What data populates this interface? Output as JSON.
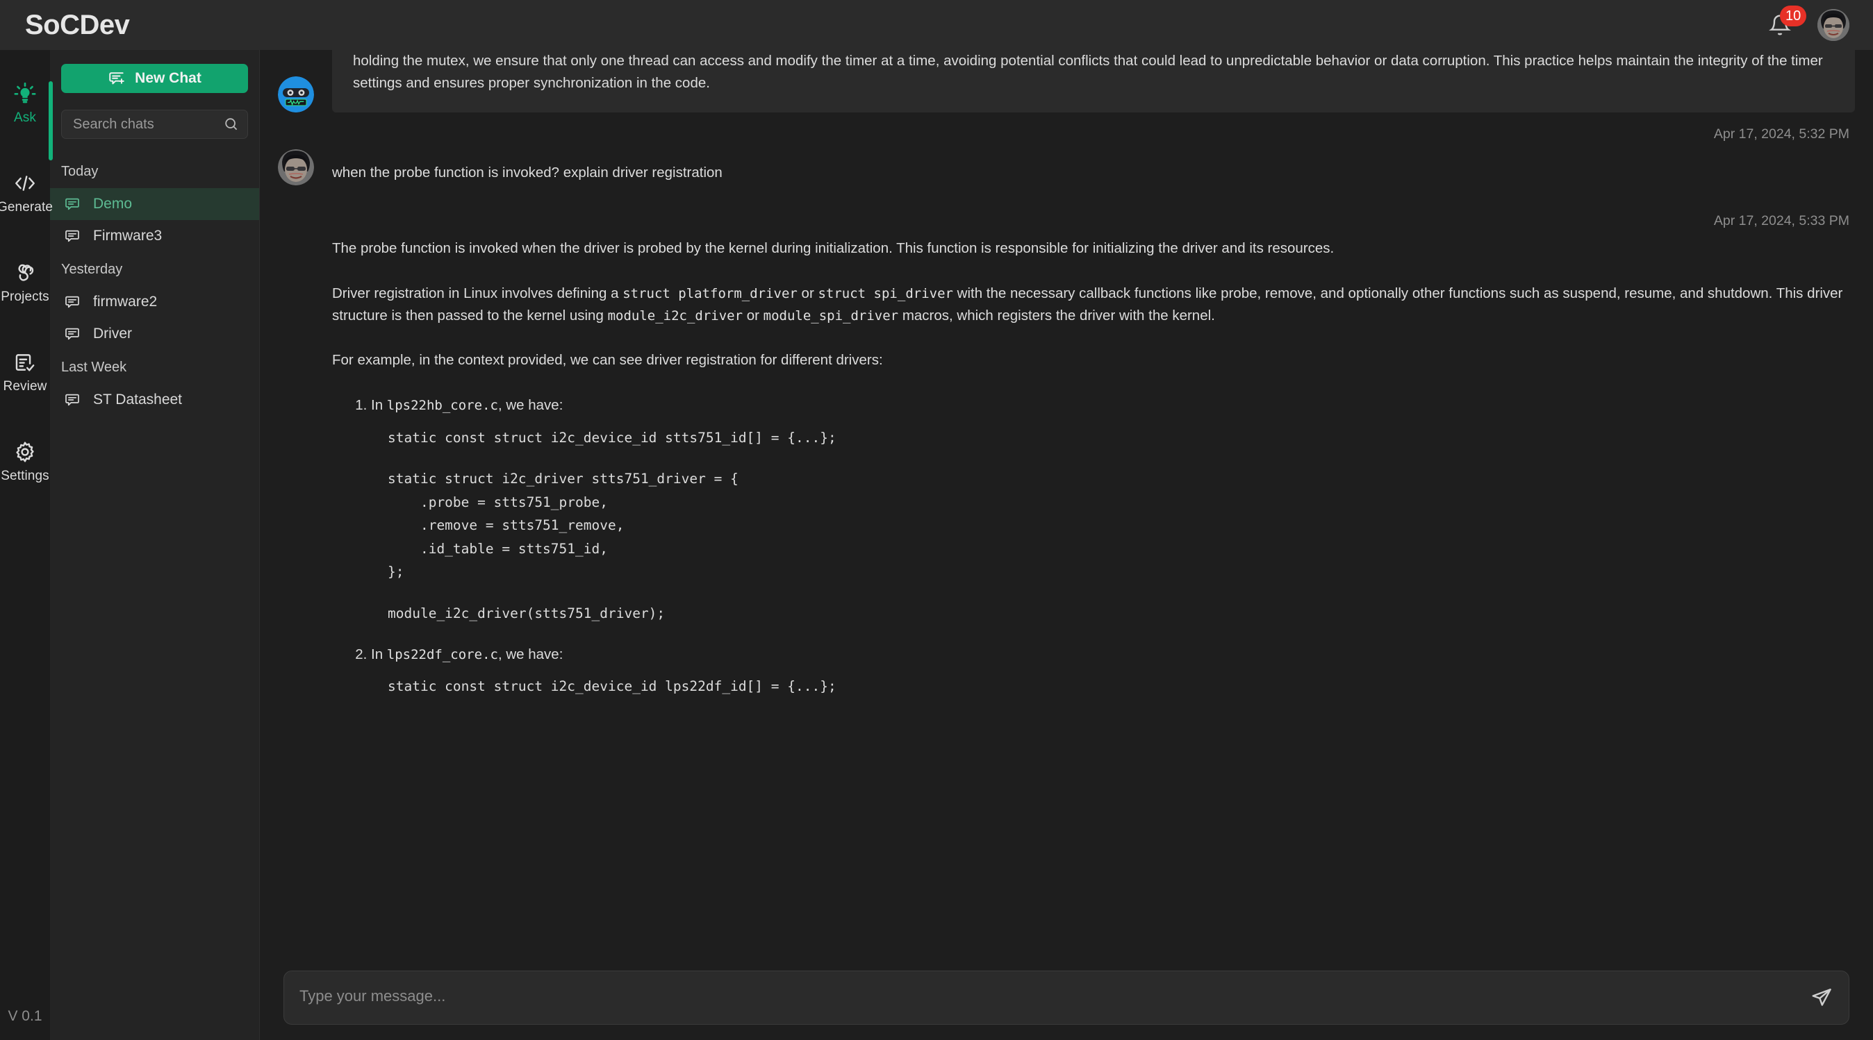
{
  "header": {
    "brand": "SoCDev",
    "notification_count": "10",
    "bell_icon": "bell-icon",
    "avatar": "user-avatar"
  },
  "rail": {
    "version": "V 0.1",
    "items": [
      {
        "label": "Ask",
        "icon": "lightbulb-icon",
        "active": true
      },
      {
        "label": "Generate",
        "icon": "code-brackets-icon",
        "active": false
      },
      {
        "label": "Projects",
        "icon": "pinwheel-icon",
        "active": false
      },
      {
        "label": "Review",
        "icon": "document-check-icon",
        "active": false
      },
      {
        "label": "Settings",
        "icon": "gear-icon",
        "active": false
      }
    ]
  },
  "sidebar": {
    "new_chat_label": "New Chat",
    "new_chat_icon": "new-message-icon",
    "search_placeholder": "Search chats",
    "search_value": "",
    "search_icon": "search-icon",
    "groups": [
      {
        "label": "Today",
        "items": [
          {
            "title": "Demo",
            "active": true
          },
          {
            "title": "Firmware3",
            "active": false
          }
        ]
      },
      {
        "label": "Yesterday",
        "items": [
          {
            "title": "firmware2",
            "active": false
          },
          {
            "title": "Driver",
            "active": false
          }
        ]
      },
      {
        "label": "Last Week",
        "items": [
          {
            "title": "ST Datasheet",
            "active": false
          }
        ]
      }
    ]
  },
  "thread": {
    "bot_message_partial": "holding the mutex, we ensure that only one thread can access and modify the timer at a time, avoiding potential conflicts that could lead to unpredictable behavior or data corruption. This practice helps maintain the integrity of the timer settings and ensures proper synchronization in the code.",
    "user_timestamp": "Apr 17, 2024, 5:32 PM",
    "user_message": "when the probe function is invoked? explain driver registration",
    "answer_timestamp": "Apr 17, 2024, 5:33 PM",
    "answer": {
      "para1": "The probe function is invoked when the driver is probed by the kernel during initialization. This function is responsible for initializing the driver and its resources.",
      "para2_a": "Driver registration in Linux involves defining a ",
      "para2_code1": "struct platform_driver",
      "para2_b": " or ",
      "para2_code2": "struct spi_driver",
      "para2_c": " with the necessary callback functions like probe, remove, and optionally other functions such as suspend, resume, and shutdown. This driver structure is then passed to the kernel using ",
      "para2_code3": "module_i2c_driver",
      "para2_d": " or ",
      "para2_code4": "module_spi_driver",
      "para2_e": " macros, which registers the driver with the kernel.",
      "para3": "For example, in the context provided, we can see driver registration for different drivers:",
      "item1_pre": "In ",
      "item1_code": "lps22hb_core.c",
      "item1_post": ", we have:",
      "code1": "static const struct i2c_device_id stts751_id[] = {...};",
      "code2": "static struct i2c_driver stts751_driver = {\n    .probe = stts751_probe,\n    .remove = stts751_remove,\n    .id_table = stts751_id,\n};",
      "code3": "module_i2c_driver(stts751_driver);",
      "item2_pre": "In ",
      "item2_code": "lps22df_core.c",
      "item2_post": ", we have:",
      "code4": "static const struct i2c_device_id lps22df_id[] = {...};"
    }
  },
  "composer": {
    "placeholder": "Type your message...",
    "value": "",
    "send_icon": "send-icon"
  },
  "colors": {
    "accent_green": "#12a36e",
    "active_green": "#12b27a",
    "badge_red": "#e73127",
    "bot_avatar_blue": "#1f8fe0"
  }
}
